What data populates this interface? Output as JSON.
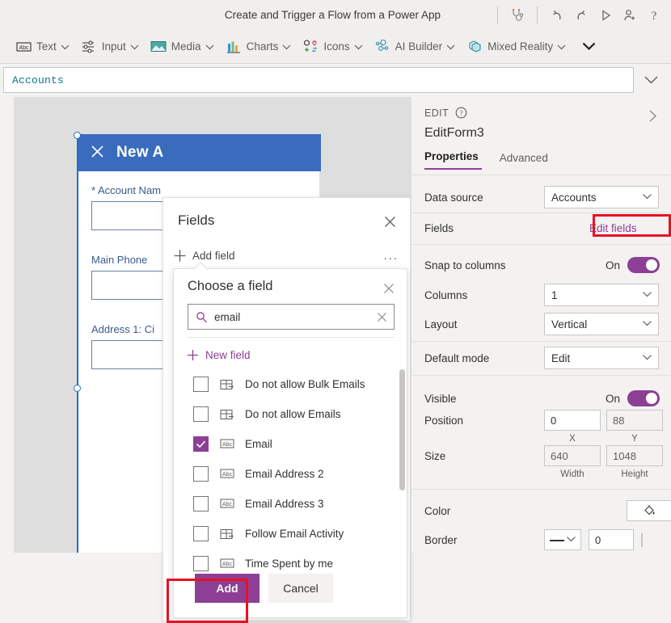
{
  "header": {
    "title": "Create and Trigger a Flow from a Power App",
    "icons": [
      {
        "name": "app-checker-icon",
        "label": "App checker"
      },
      {
        "name": "undo-icon",
        "label": "Undo"
      },
      {
        "name": "redo-icon",
        "label": "Redo"
      },
      {
        "name": "play-preview-icon",
        "label": "Preview the app"
      },
      {
        "name": "share-user-icon",
        "label": "Share"
      },
      {
        "name": "help-icon",
        "label": "Help"
      }
    ]
  },
  "ribbon": {
    "items": [
      {
        "label": "Text",
        "icon": "abc-text-icon"
      },
      {
        "label": "Input",
        "icon": "sliders-input-icon"
      },
      {
        "label": "Media",
        "icon": "image-media-icon"
      },
      {
        "label": "Charts",
        "icon": "bar-chart-icon"
      },
      {
        "label": "Icons",
        "icon": "shapes-icons-icon"
      },
      {
        "label": "AI Builder",
        "icon": "ai-builder-icon"
      },
      {
        "label": "Mixed Reality",
        "icon": "mixed-reality-icon"
      }
    ],
    "overflow_label": "More"
  },
  "formula_bar": {
    "value": "Accounts",
    "expand_label": "Expand formula bar"
  },
  "canvas": {
    "form_title": "New A",
    "close_label": "Close",
    "fields": [
      {
        "label": "Account Nam",
        "required": true
      },
      {
        "label": "Main Phone",
        "required": false
      },
      {
        "label": "Address 1: Ci",
        "required": false
      }
    ]
  },
  "fields_panel": {
    "title": "Fields",
    "close_label": "Close",
    "add_field_label": "Add field",
    "overflow_label": "..."
  },
  "choose_field": {
    "title": "Choose a field",
    "close_label": "Close",
    "search": {
      "value": "email",
      "placeholder": "Search",
      "clear_label": "Clear"
    },
    "new_field_label": "New field",
    "items": [
      {
        "name": "Do not allow Bulk Emails",
        "type_icon": "two-option-icon",
        "checked": false
      },
      {
        "name": "Do not allow Emails",
        "type_icon": "two-option-icon",
        "checked": false
      },
      {
        "name": "Email",
        "type_icon": "abc-text-icon",
        "checked": true
      },
      {
        "name": "Email Address 2",
        "type_icon": "abc-text-icon",
        "checked": false
      },
      {
        "name": "Email Address 3",
        "type_icon": "abc-text-icon",
        "checked": false
      },
      {
        "name": "Follow Email Activity",
        "type_icon": "two-option-icon",
        "checked": false
      },
      {
        "name": "Time Spent by me",
        "type_icon": "abc-text-icon",
        "checked": false
      }
    ],
    "add_label": "Add",
    "cancel_label": "Cancel"
  },
  "properties_pane": {
    "section_label": "EDIT",
    "help_label": "Help",
    "collapse_label": "Collapse pane",
    "control_name": "EditForm3",
    "tabs": [
      {
        "label": "Properties",
        "active": true
      },
      {
        "label": "Advanced",
        "active": false
      }
    ],
    "data_source": {
      "label": "Data source",
      "value": "Accounts"
    },
    "fields": {
      "label": "Fields",
      "link_label": "Edit fields"
    },
    "snap_to_columns": {
      "label": "Snap to columns",
      "state": "On"
    },
    "columns": {
      "label": "Columns",
      "value": "1"
    },
    "layout": {
      "label": "Layout",
      "value": "Vertical"
    },
    "default_mode": {
      "label": "Default mode",
      "value": "Edit"
    },
    "visible": {
      "label": "Visible",
      "state": "On"
    },
    "position": {
      "label": "Position",
      "x": "0",
      "y": "88",
      "x_label": "X",
      "y_label": "Y"
    },
    "size": {
      "label": "Size",
      "width": "640",
      "height": "1048",
      "width_label": "Width",
      "height_label": "Height"
    },
    "color": {
      "label": "Color"
    },
    "border": {
      "label": "Border",
      "width": "0",
      "color_hex": "#0b2265"
    }
  },
  "accents": {
    "purple": "#8d3f95",
    "highlight_red": "#e81123",
    "formula_teal": "#0e7490",
    "form_blue": "#3a6cbe"
  }
}
